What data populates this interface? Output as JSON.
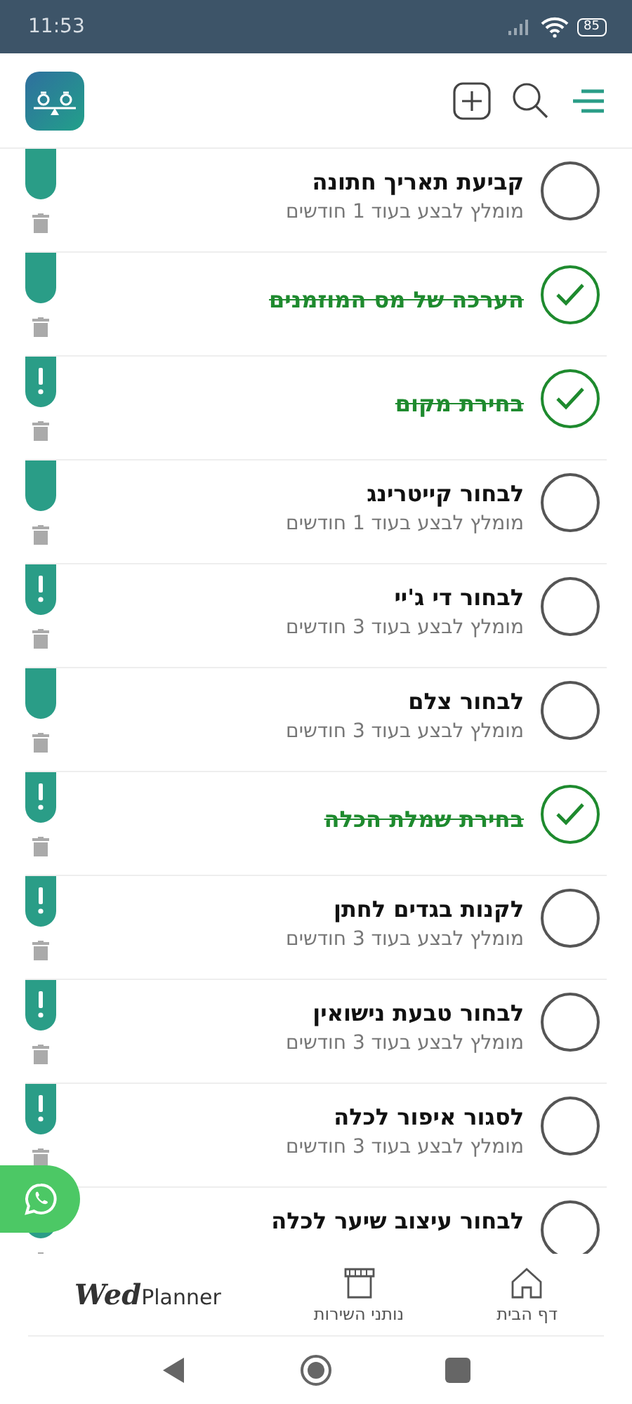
{
  "status_bar": {
    "time": "11:53",
    "battery": "85"
  },
  "tasks": [
    {
      "title": "קביעת תאריך חתונה",
      "hint": "מומלץ לבצע בעוד 1 חודשים",
      "done": false,
      "urgent": false
    },
    {
      "title": "הערכה של מס המוזמנים",
      "done": true,
      "urgent": false
    },
    {
      "title": "בחירת מקום",
      "done": true,
      "urgent": true
    },
    {
      "title": "לבחור קייטרינג",
      "hint": "מומלץ לבצע בעוד 1 חודשים",
      "done": false,
      "urgent": false
    },
    {
      "title": "לבחור די ג'יי",
      "hint": "מומלץ לבצע בעוד 3 חודשים",
      "done": false,
      "urgent": true
    },
    {
      "title": "לבחור צלם",
      "hint": "מומלץ לבצע בעוד 3 חודשים",
      "done": false,
      "urgent": false
    },
    {
      "title": "בחירת שמלת הכלה",
      "done": true,
      "urgent": true
    },
    {
      "title": "לקנות בגדים לחתן",
      "hint": "מומלץ לבצע בעוד 3 חודשים",
      "done": false,
      "urgent": true
    },
    {
      "title": "לבחור טבעת נישואין",
      "hint": "מומלץ לבצע בעוד 3 חודשים",
      "done": false,
      "urgent": true
    },
    {
      "title": "לסגור איפור לכלה",
      "hint": "מומלץ לבצע בעוד 3 חודשים",
      "done": false,
      "urgent": true
    },
    {
      "title": "לבחור עיצוב שיער לכלה",
      "done": false
    }
  ],
  "bottom_nav": {
    "logo": {
      "script": "Wed",
      "text": "Planner"
    },
    "items": [
      {
        "kind": "home",
        "label": "דף הבית",
        "selected": false
      },
      {
        "kind": "store",
        "label": "נותני השירות",
        "selected": false
      }
    ]
  }
}
